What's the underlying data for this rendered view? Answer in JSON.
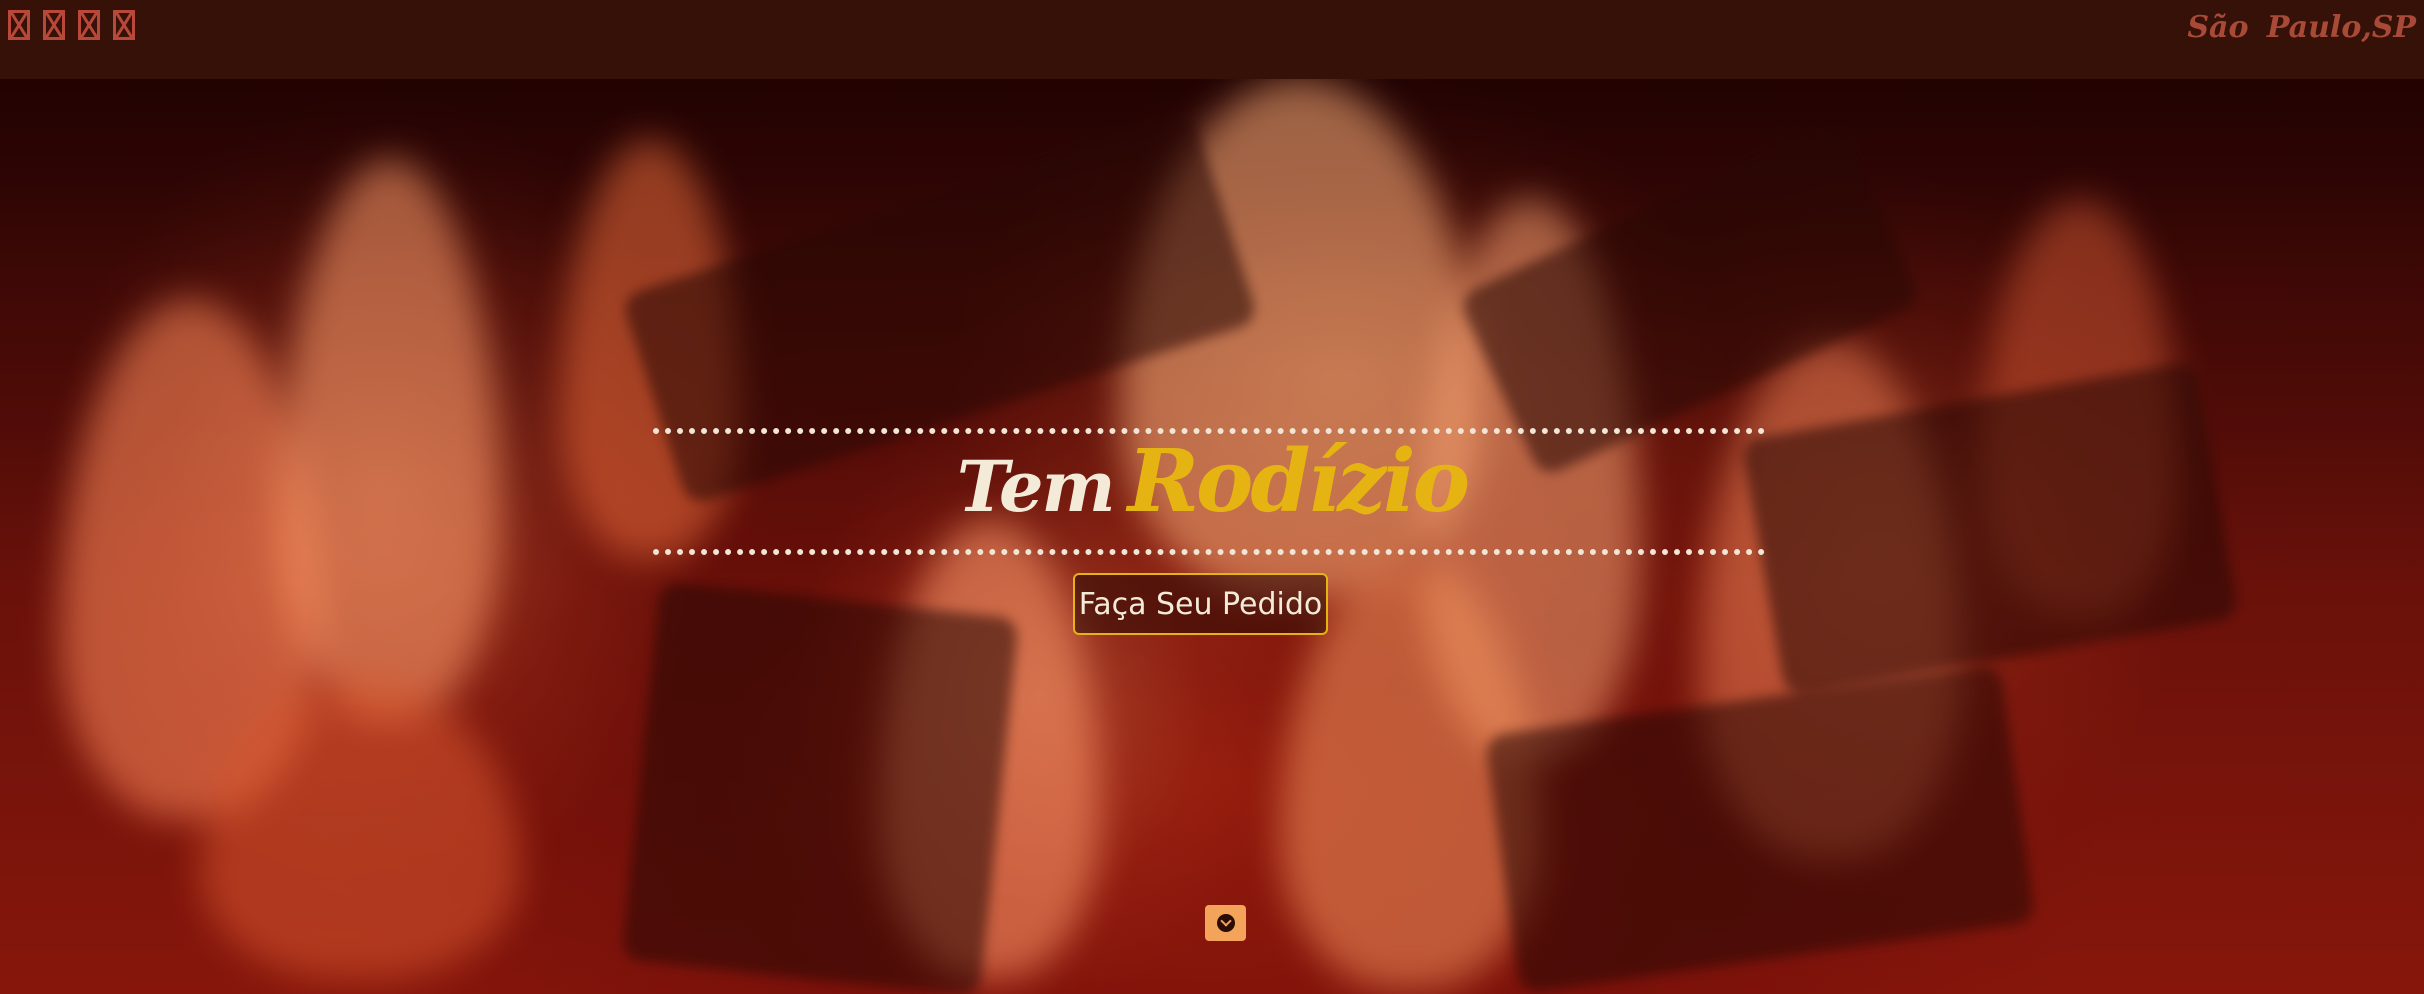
{
  "topbar": {
    "social_icons": [
      {
        "name": "social-icon-1"
      },
      {
        "name": "social-icon-2"
      },
      {
        "name": "social-icon-3"
      },
      {
        "name": "social-icon-4"
      }
    ],
    "location": "São  Paulo,SP"
  },
  "hero": {
    "title_word1": "Tem",
    "title_word2": "Rodízio",
    "cta_label": "Faça Seu Pedido",
    "scroll_icon": "chevron-down-circle-icon"
  },
  "colors": {
    "topbar_bg": "#361108",
    "accent_gold": "#e6b412",
    "title_cream": "#f4ead8",
    "scroll_button": "#f3a35a",
    "location_text": "#a94a38"
  }
}
